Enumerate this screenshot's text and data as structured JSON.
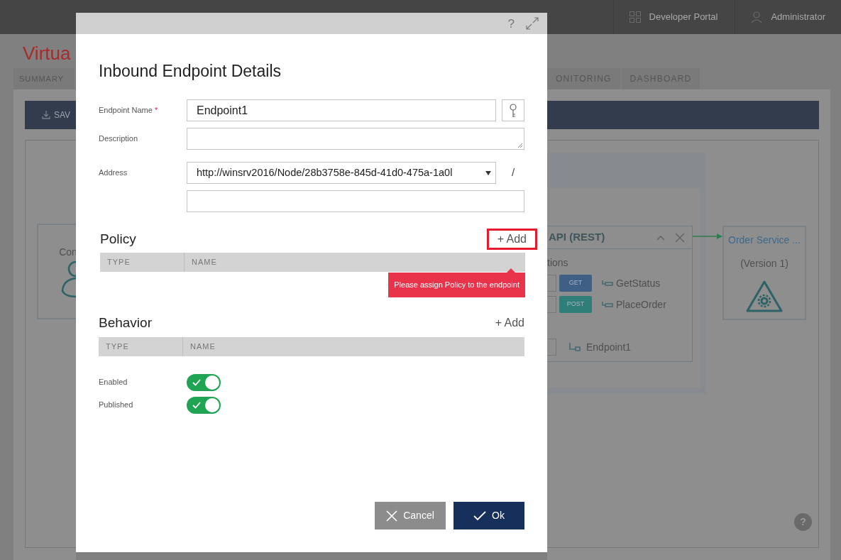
{
  "top_bar": {
    "links": [
      {
        "label": "Developer Portal"
      },
      {
        "label": "Administrator"
      }
    ]
  },
  "page": {
    "title": "Virtua",
    "tabs": [
      {
        "label": "SUMMARY"
      },
      {
        "label": "ONITORING"
      },
      {
        "label": "DASHBOARD"
      }
    ],
    "save_label": "SAV",
    "help": "?",
    "canvas": {
      "consumer": {
        "label": "Con"
      },
      "api": {
        "title": "API (REST)",
        "section": "tions",
        "operations": [
          {
            "method": "GET",
            "color": "#3f5f85",
            "name": "GetStatus"
          },
          {
            "method": "POST",
            "color": "#2f7f78",
            "name": "PlaceOrder"
          }
        ],
        "endpoint": "Endpoint1"
      },
      "service": {
        "title": "Order Service ...",
        "version": "(Version 1)"
      }
    }
  },
  "dialog": {
    "help": "?",
    "title": "Inbound Endpoint Details",
    "fields": [
      {
        "kind": "text_with_key",
        "label": "Endpoint Name",
        "required_mark": "*",
        "value": "Endpoint1"
      },
      {
        "kind": "textarea",
        "label": "Description"
      },
      {
        "kind": "select",
        "label": "Address",
        "value": "http://winsrv2016/Node/28b3758e-845d-41d0-475a-1a0l",
        "suffix": "/"
      },
      {
        "kind": "text"
      }
    ],
    "sections": [
      {
        "title": "Policy",
        "add": "+ Add",
        "highlighted": true,
        "columns": [
          "TYPE",
          "NAME"
        ],
        "error": "Please assign Policy to the endpoint"
      },
      {
        "title": "Behavior",
        "add": "+ Add",
        "highlighted": false,
        "columns": [
          "TYPE",
          "NAME"
        ]
      }
    ],
    "toggles": [
      {
        "label": "Enabled",
        "on": true
      },
      {
        "label": "Published",
        "on": true
      }
    ],
    "buttons": [
      {
        "kind": "cancel",
        "label": "Cancel"
      },
      {
        "kind": "ok",
        "label": "Ok"
      }
    ]
  }
}
